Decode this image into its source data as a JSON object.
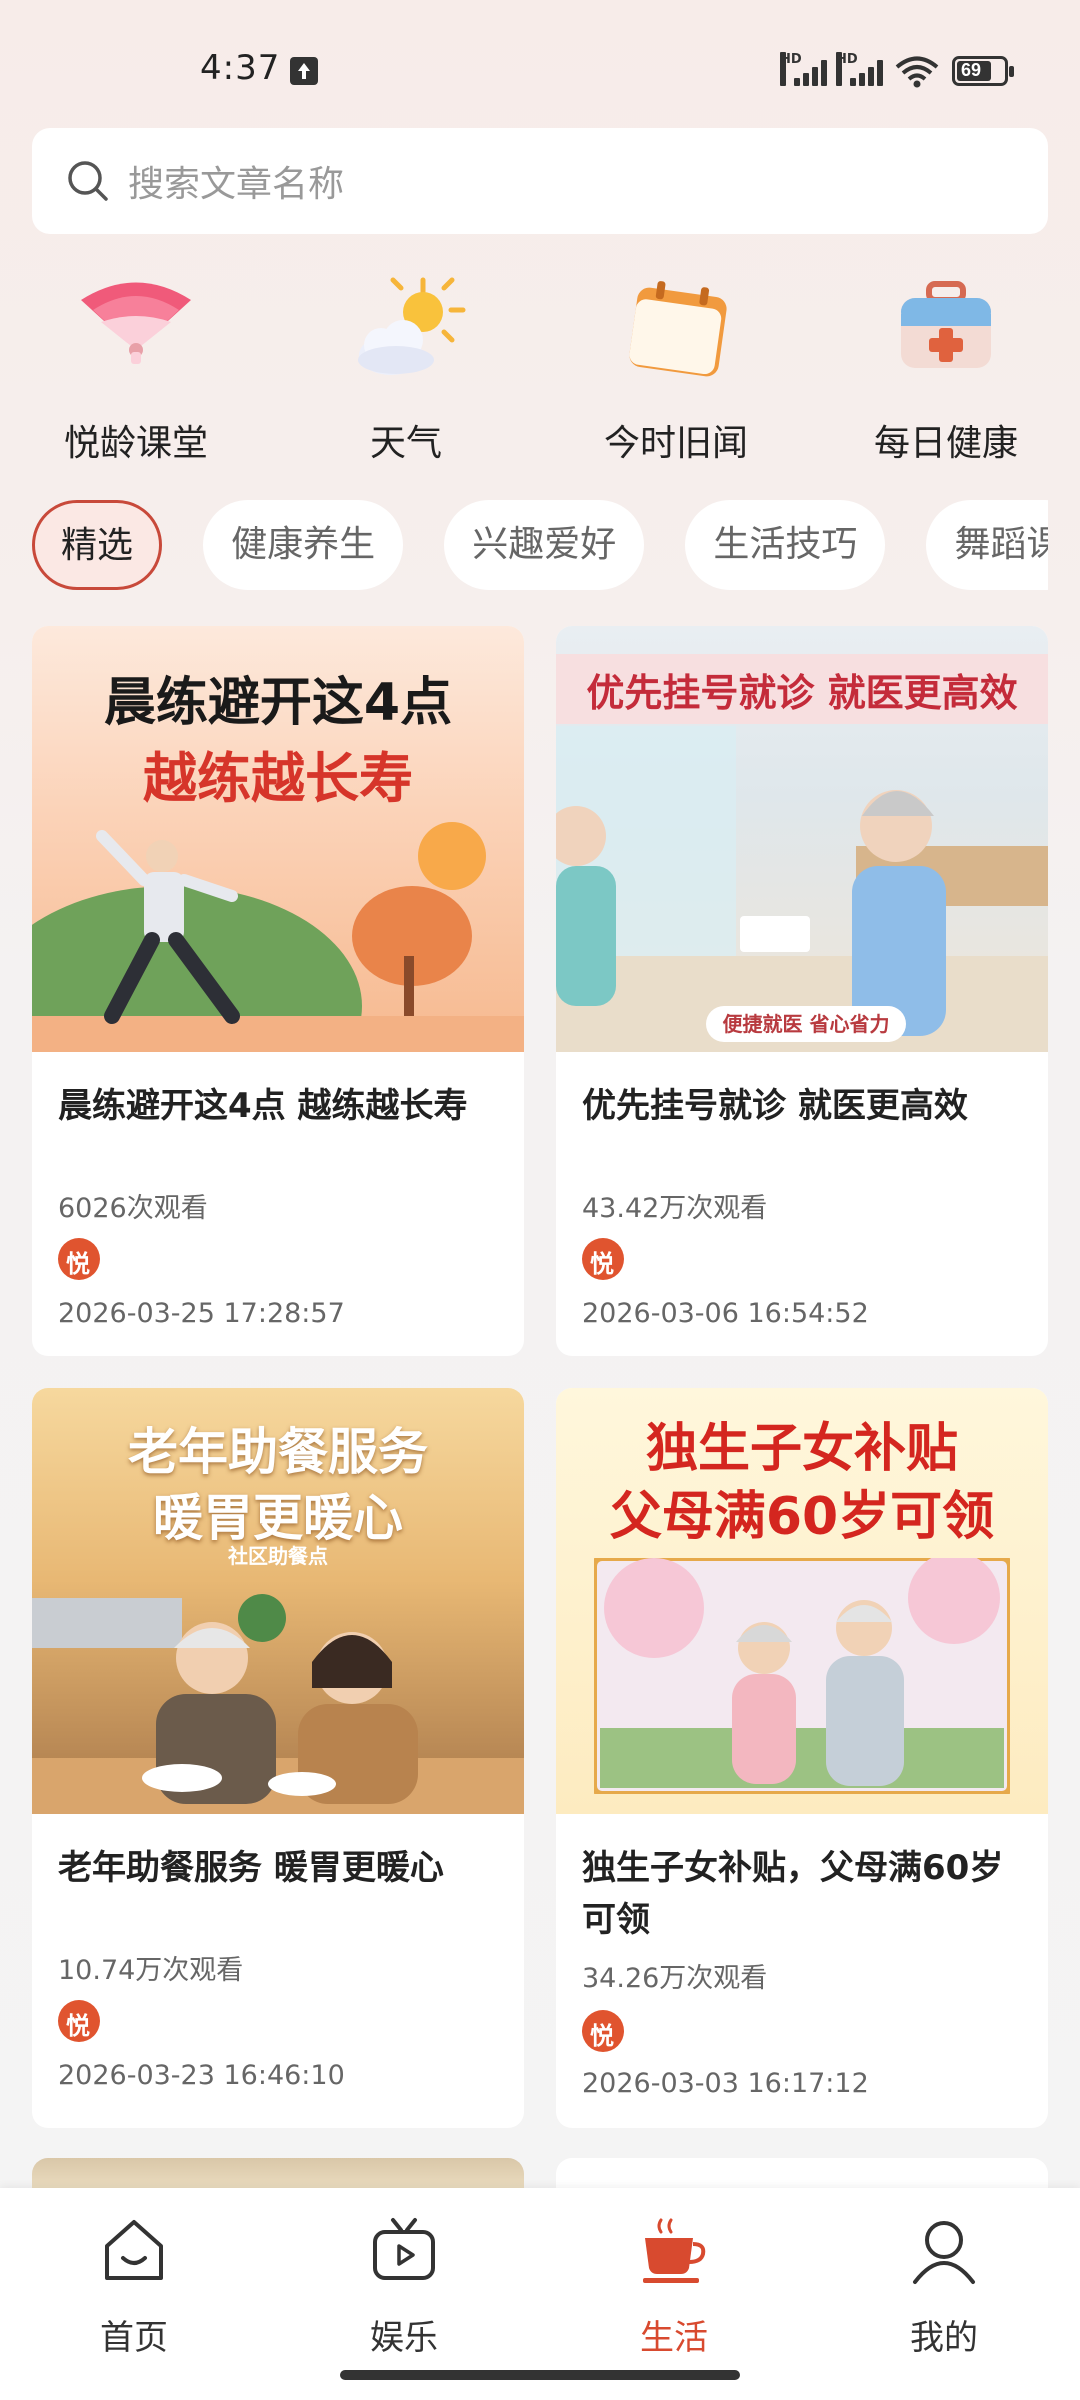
{
  "status_bar": {
    "time": "4:37",
    "battery": "69",
    "hd1": "HD",
    "hd2": "HD"
  },
  "search": {
    "placeholder": "搜索文章名称"
  },
  "quick_entries": [
    {
      "label": "悦龄课堂",
      "icon": "fan-icon"
    },
    {
      "label": "天气",
      "icon": "weather-icon"
    },
    {
      "label": "今时旧闻",
      "icon": "calendar-icon"
    },
    {
      "label": "每日健康",
      "icon": "medical-kit-icon"
    }
  ],
  "tabs": [
    "精选",
    "健康养生",
    "兴趣爱好",
    "生活技巧",
    "舞蹈课"
  ],
  "active_tab": "精选",
  "articles": [
    {
      "img_line1": "晨练避开这4点",
      "img_line2": "越练越长寿",
      "title": "晨练避开这4点 越练越长寿",
      "views": "6026次观看",
      "date": "2026-03-25 17:28:57"
    },
    {
      "img_line1": "优先挂号就诊 就医更高效",
      "img_caption": "便捷就医 省心省力",
      "title": "优先挂号就诊 就医更高效",
      "views": "43.42万次观看",
      "date": "2026-03-06 16:54:52"
    },
    {
      "img_line1": "老年助餐服务",
      "img_line2": "暖胃更暖心",
      "img_caption": "社区助餐点",
      "title": "老年助餐服务  暖胃更暖心",
      "views": "10.74万次观看",
      "date": "2026-03-23 16:46:10"
    },
    {
      "img_line1": "独生子女补贴",
      "img_line2": "父母满60岁可领",
      "title": "独生子女补贴，父母满60岁可领",
      "views": "34.26万次观看",
      "date": "2026-03-03 16:17:12"
    }
  ],
  "bottom_nav": [
    {
      "label": "首页",
      "icon": "home-icon"
    },
    {
      "label": "娱乐",
      "icon": "tv-icon"
    },
    {
      "label": "生活",
      "icon": "coffee-cup-icon"
    },
    {
      "label": "我的",
      "icon": "user-icon"
    }
  ],
  "active_nav": "生活",
  "colors": {
    "accent": "#d84a2f",
    "tab_active_border": "#c8493a"
  }
}
